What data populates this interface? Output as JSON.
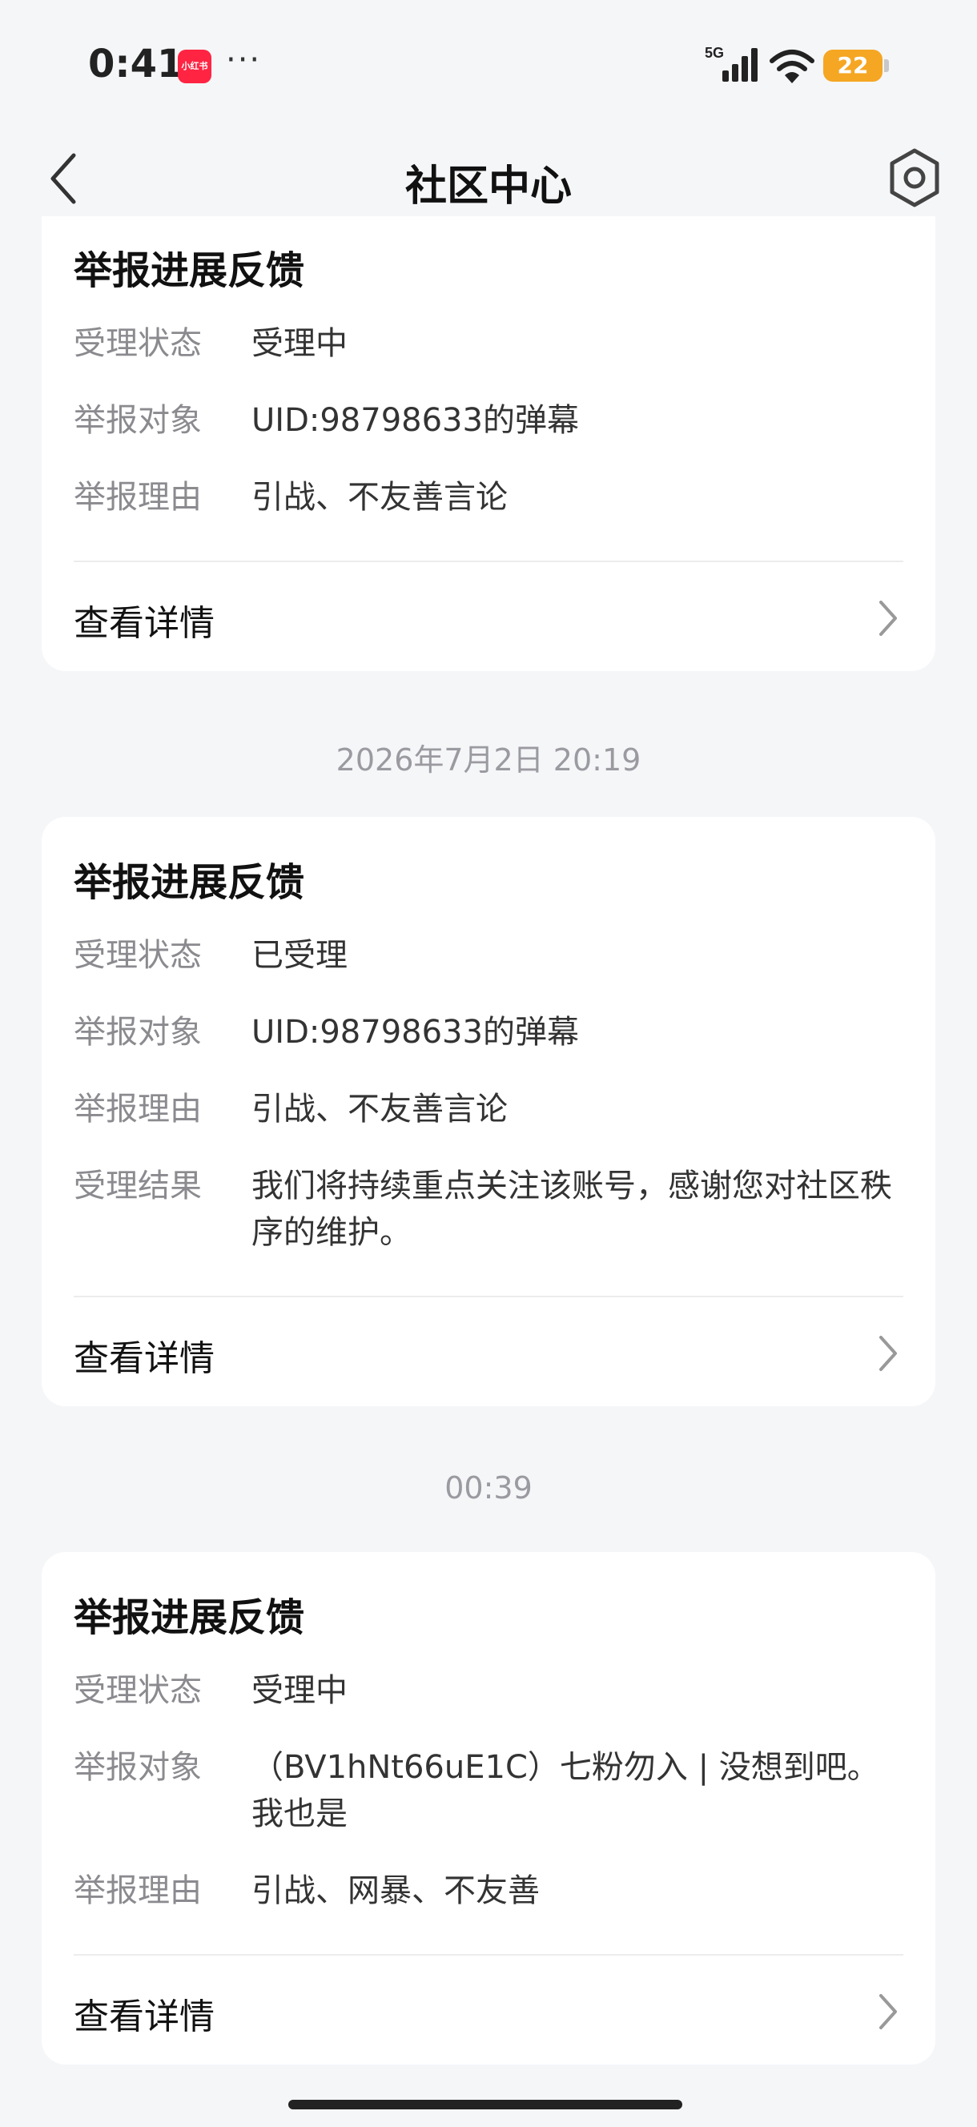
{
  "status_bar": {
    "time": "0:41",
    "app_badge": "小红书",
    "more": "···",
    "network": "5G",
    "battery": "22",
    "battery_color": "#f5a623"
  },
  "nav": {
    "title": "社区中心",
    "back_icon": "chevron-left-icon",
    "settings_icon": "gear-icon"
  },
  "cards": [
    {
      "title": "举报进展反馈",
      "rows": [
        {
          "label": "受理状态",
          "value": "受理中"
        },
        {
          "label": "举报对象",
          "value": "UID:98798633的弹幕"
        },
        {
          "label": "举报理由",
          "value": "引战、不友善言论"
        }
      ],
      "link": "查看详情"
    },
    {
      "timestamp": "2026年7月2日 20:19",
      "title": "举报进展反馈",
      "rows": [
        {
          "label": "受理状态",
          "value": "已受理"
        },
        {
          "label": "举报对象",
          "value": "UID:98798633的弹幕"
        },
        {
          "label": "举报理由",
          "value": "引战、不友善言论"
        },
        {
          "label": "受理结果",
          "value": "我们将持续重点关注该账号，感谢您对社区秩序的维护。"
        }
      ],
      "link": "查看详情"
    },
    {
      "timestamp": "00:39",
      "title": "举报进展反馈",
      "rows": [
        {
          "label": "受理状态",
          "value": "受理中"
        },
        {
          "label": "举报对象",
          "value": "（BV1hNt66uE1C）七粉勿入 | 没想到吧。我也是"
        },
        {
          "label": "举报理由",
          "value": "引战、网暴、不友善"
        }
      ],
      "link": "查看详情"
    }
  ]
}
